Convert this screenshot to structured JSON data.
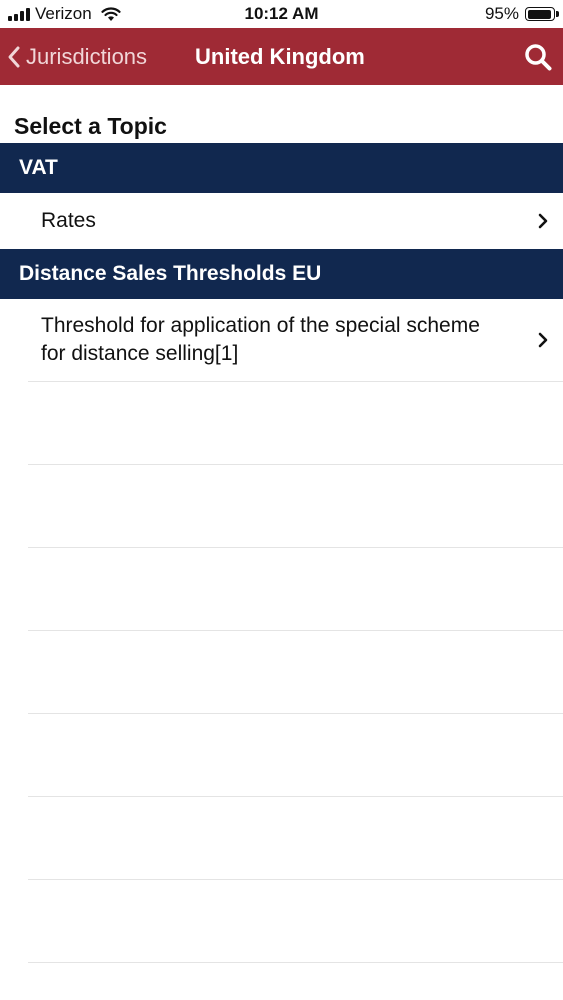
{
  "status_bar": {
    "carrier": "Verizon",
    "time": "10:12 AM",
    "battery_percent": "95%",
    "battery_level": 0.95,
    "icons": [
      "signal-icon",
      "wifi-icon",
      "battery-icon"
    ]
  },
  "nav": {
    "back_label": "Jurisdictions",
    "title": "United Kingdom",
    "icons": [
      "chevron-left-icon",
      "search-icon"
    ]
  },
  "page": {
    "heading": "Select a Topic"
  },
  "sections": [
    {
      "title": "VAT",
      "items": [
        {
          "label": "Rates"
        }
      ]
    },
    {
      "title": "Distance Sales Thresholds EU",
      "items": [
        {
          "label": "Threshold for application of the special scheme for distance selling[1]"
        }
      ]
    }
  ],
  "colors": {
    "nav_background": "#9f2a35",
    "section_header_background": "#11284f",
    "separator": "#e4e4e4"
  }
}
